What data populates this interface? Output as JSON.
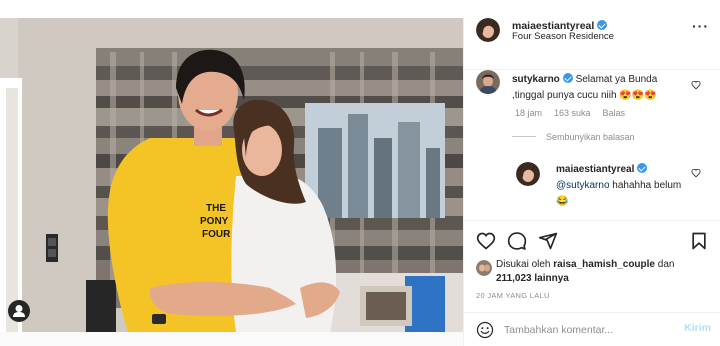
{
  "post": {
    "username": "maiaestiantyreal",
    "location": "Four Season Residence",
    "more_icon": "more-horizontal-icon"
  },
  "comment": {
    "username": "sutykarno",
    "text": "Selamat ya Bunda ,tinggal punya cucu niih 😍😍😍",
    "time": "18 jam",
    "likes": "163 suka",
    "reply": "Balas"
  },
  "hide_replies": "Sembunyikan balasan",
  "reply": {
    "username": "maiaestiantyreal",
    "mention": "@sutykarno",
    "text": " hahahha belum 😂"
  },
  "likes": {
    "prefix": "Disukai oleh",
    "user": "raisa_hamish_couple",
    "conjunction": "dan",
    "count": "211,023",
    "suffix": "lainnya"
  },
  "time_ago": "20 JAM YANG LALU",
  "add_comment": {
    "placeholder": "Tambahkan komentar...",
    "post_label": "Kirim"
  },
  "colors": {
    "verified": "#3897f0",
    "post_button": "#b2dffc",
    "shirt": "#f4c426"
  }
}
